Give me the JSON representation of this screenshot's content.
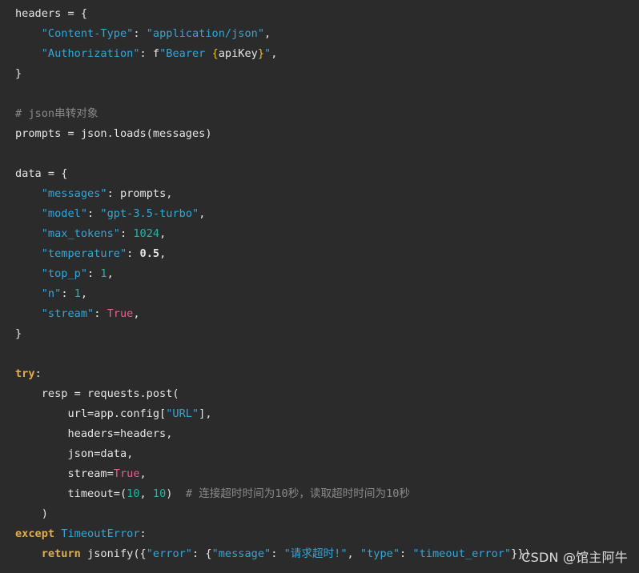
{
  "code": {
    "lines": [
      [
        {
          "t": "headers = {",
          "c": "plain"
        }
      ],
      [
        {
          "t": "    ",
          "c": "plain"
        },
        {
          "t": "\"Content-Type\"",
          "c": "string"
        },
        {
          "t": ": ",
          "c": "plain"
        },
        {
          "t": "\"application/json\"",
          "c": "string"
        },
        {
          "t": ",",
          "c": "plain"
        }
      ],
      [
        {
          "t": "    ",
          "c": "plain"
        },
        {
          "t": "\"Authorization\"",
          "c": "string"
        },
        {
          "t": ": f",
          "c": "plain"
        },
        {
          "t": "\"Bearer ",
          "c": "string"
        },
        {
          "t": "{",
          "c": "bracket"
        },
        {
          "t": "apiKey",
          "c": "plain"
        },
        {
          "t": "}",
          "c": "bracket"
        },
        {
          "t": "\"",
          "c": "string"
        },
        {
          "t": ",",
          "c": "plain"
        }
      ],
      [
        {
          "t": "}",
          "c": "plain"
        }
      ],
      [],
      [
        {
          "t": "# json串转对象",
          "c": "comment"
        }
      ],
      [
        {
          "t": "prompts = json.loads(messages)",
          "c": "plain"
        }
      ],
      [],
      [
        {
          "t": "data = {",
          "c": "plain"
        }
      ],
      [
        {
          "t": "    ",
          "c": "plain"
        },
        {
          "t": "\"messages\"",
          "c": "string"
        },
        {
          "t": ": prompts,",
          "c": "plain"
        }
      ],
      [
        {
          "t": "    ",
          "c": "plain"
        },
        {
          "t": "\"model\"",
          "c": "string"
        },
        {
          "t": ": ",
          "c": "plain"
        },
        {
          "t": "\"gpt-3.5-turbo\"",
          "c": "string"
        },
        {
          "t": ",",
          "c": "plain"
        }
      ],
      [
        {
          "t": "    ",
          "c": "plain"
        },
        {
          "t": "\"max_tokens\"",
          "c": "string"
        },
        {
          "t": ": ",
          "c": "plain"
        },
        {
          "t": "1024",
          "c": "number"
        },
        {
          "t": ",",
          "c": "plain"
        }
      ],
      [
        {
          "t": "    ",
          "c": "plain"
        },
        {
          "t": "\"temperature\"",
          "c": "string"
        },
        {
          "t": ": ",
          "c": "plain"
        },
        {
          "t": "0.5",
          "c": "bold"
        },
        {
          "t": ",",
          "c": "plain"
        }
      ],
      [
        {
          "t": "    ",
          "c": "plain"
        },
        {
          "t": "\"top_p\"",
          "c": "string"
        },
        {
          "t": ": ",
          "c": "plain"
        },
        {
          "t": "1",
          "c": "number"
        },
        {
          "t": ",",
          "c": "plain"
        }
      ],
      [
        {
          "t": "    ",
          "c": "plain"
        },
        {
          "t": "\"n\"",
          "c": "string"
        },
        {
          "t": ": ",
          "c": "plain"
        },
        {
          "t": "1",
          "c": "number"
        },
        {
          "t": ",",
          "c": "plain"
        }
      ],
      [
        {
          "t": "    ",
          "c": "plain"
        },
        {
          "t": "\"stream\"",
          "c": "string"
        },
        {
          "t": ": ",
          "c": "plain"
        },
        {
          "t": "True",
          "c": "bool"
        },
        {
          "t": ",",
          "c": "plain"
        }
      ],
      [
        {
          "t": "}",
          "c": "plain"
        }
      ],
      [],
      [
        {
          "t": "try",
          "c": "keyword"
        },
        {
          "t": ":",
          "c": "plain"
        }
      ],
      [
        {
          "t": "    resp = requests.post(",
          "c": "plain"
        }
      ],
      [
        {
          "t": "        url=app.config[",
          "c": "plain"
        },
        {
          "t": "\"URL\"",
          "c": "string"
        },
        {
          "t": "],",
          "c": "plain"
        }
      ],
      [
        {
          "t": "        headers=headers,",
          "c": "plain"
        }
      ],
      [
        {
          "t": "        json=data,",
          "c": "plain"
        }
      ],
      [
        {
          "t": "        stream=",
          "c": "plain"
        },
        {
          "t": "True",
          "c": "bool"
        },
        {
          "t": ",",
          "c": "plain"
        }
      ],
      [
        {
          "t": "        timeout=(",
          "c": "plain"
        },
        {
          "t": "10",
          "c": "number"
        },
        {
          "t": ", ",
          "c": "plain"
        },
        {
          "t": "10",
          "c": "number"
        },
        {
          "t": ")  ",
          "c": "plain"
        },
        {
          "t": "# 连接超时时间为10秒，读取超时时间为10秒",
          "c": "comment"
        }
      ],
      [
        {
          "t": "    )",
          "c": "plain"
        }
      ],
      [
        {
          "t": "except",
          "c": "keyword"
        },
        {
          "t": " ",
          "c": "plain"
        },
        {
          "t": "TimeoutError",
          "c": "class"
        },
        {
          "t": ":",
          "c": "plain"
        }
      ],
      [
        {
          "t": "    ",
          "c": "plain"
        },
        {
          "t": "return",
          "c": "keyword"
        },
        {
          "t": " jsonify({",
          "c": "plain"
        },
        {
          "t": "\"error\"",
          "c": "string"
        },
        {
          "t": ": {",
          "c": "plain"
        },
        {
          "t": "\"message\"",
          "c": "string"
        },
        {
          "t": ": ",
          "c": "plain"
        },
        {
          "t": "\"请求超时!\"",
          "c": "string"
        },
        {
          "t": ", ",
          "c": "plain"
        },
        {
          "t": "\"type\"",
          "c": "string"
        },
        {
          "t": ": ",
          "c": "plain"
        },
        {
          "t": "\"timeout_error\"",
          "c": "string"
        },
        {
          "t": "}})",
          "c": "plain"
        }
      ]
    ]
  },
  "watermark": {
    "text": "CSDN @馆主阿牛"
  }
}
